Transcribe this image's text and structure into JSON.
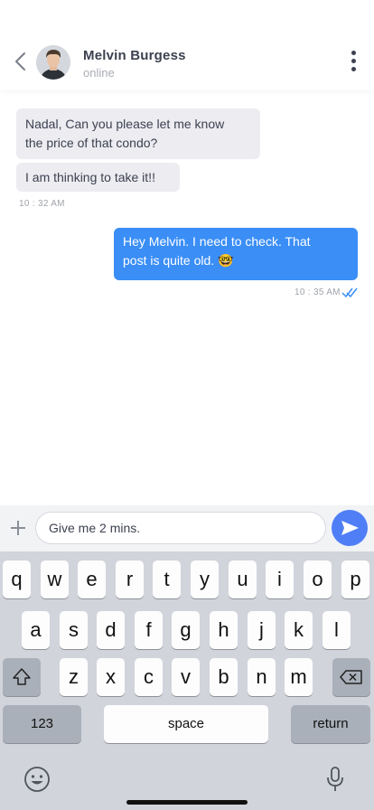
{
  "contact": {
    "name": "Melvin Burgess",
    "status": "online"
  },
  "messages": {
    "in_1": {
      "lines": [
        "Nadal, Can you please let me know",
        "the price of that condo?"
      ]
    },
    "in_2": {
      "text": "I am thinking to take it!!"
    },
    "in_time": "10 : 32 AM",
    "out_1": {
      "lines": [
        "Hey Melvin. I need to check. That",
        "post is quite old. 🤓"
      ]
    },
    "out_time": "10 : 35 AM"
  },
  "composer": {
    "value": "Give me 2 mins."
  },
  "keyboard": {
    "row1": [
      "q",
      "w",
      "e",
      "r",
      "t",
      "y",
      "u",
      "i",
      "o",
      "p"
    ],
    "row2": [
      "a",
      "s",
      "d",
      "f",
      "g",
      "h",
      "j",
      "k",
      "l"
    ],
    "row3": [
      "z",
      "x",
      "c",
      "v",
      "b",
      "n",
      "m"
    ],
    "numbers_label": "123",
    "space_label": "space",
    "return_label": "return"
  },
  "colors": {
    "outgoing_bubble": "#3a8ef6",
    "send_button": "#4f7ef7",
    "incoming_bubble": "#ececf1"
  }
}
